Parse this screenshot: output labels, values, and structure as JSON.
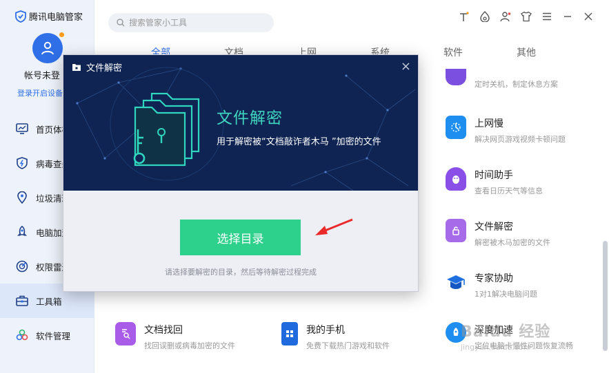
{
  "app": {
    "title": "腾讯电脑管家"
  },
  "user": {
    "name": "帐号未登",
    "login_link": "登录开启设备"
  },
  "sidebar": {
    "items": [
      {
        "label": "首页体检",
        "icon": "monitor-icon"
      },
      {
        "label": "病毒查杀",
        "icon": "shield-bolt-icon"
      },
      {
        "label": "垃圾清理",
        "icon": "location-pin-icon"
      },
      {
        "label": "电脑加速",
        "icon": "rocket-icon"
      },
      {
        "label": "权限雷达",
        "icon": "radar-icon"
      },
      {
        "label": "工具箱",
        "icon": "toolbox-icon"
      },
      {
        "label": "软件管理",
        "icon": "apps-icon"
      }
    ]
  },
  "search": {
    "placeholder": "搜索管家小工具"
  },
  "tabs": [
    "全部",
    "文档",
    "上网",
    "系统",
    "软件",
    "其他"
  ],
  "tools": {
    "shutdown": {
      "desc": "定时关机，制定休息方案"
    },
    "slow_net": {
      "title": "上网慢",
      "desc": "解决网页游戏视频卡顿问题"
    },
    "time_helper": {
      "title": "时间助手",
      "desc": "查看日历天气等信息"
    },
    "file_decrypt": {
      "title": "文件解密",
      "desc": "解密被木马加密的文件"
    },
    "expert": {
      "title": "专家协助",
      "desc": "1对1解决电脑问题"
    },
    "doc_recover": {
      "title": "文档找回",
      "desc": "找回误删或病毒加密的文件"
    },
    "my_phone": {
      "title": "我的手机",
      "desc": "免费下载热门游戏和软件"
    },
    "deep_speed": {
      "title": "深度加速",
      "desc": "定位电脑卡慢性问题恢复流畅"
    }
  },
  "modal": {
    "title": "文件解密",
    "hero_title": "文件解密",
    "hero_subtitle": "用于解密被“文档敲诈者木马 ”加密的文件",
    "button": "选择目录",
    "hint": "请选择要解密的目录，然后等待解密过程完成"
  },
  "watermark": {
    "title": "Baidu 经验",
    "url": "jingyan.baidu.com"
  },
  "colors": {
    "accent_blue": "#2f6fe8",
    "modal_header": "#0f2453",
    "hero_teal": "#3fd6bf",
    "button_green": "#2dd18b",
    "arrow_red": "#ea2a2a"
  }
}
